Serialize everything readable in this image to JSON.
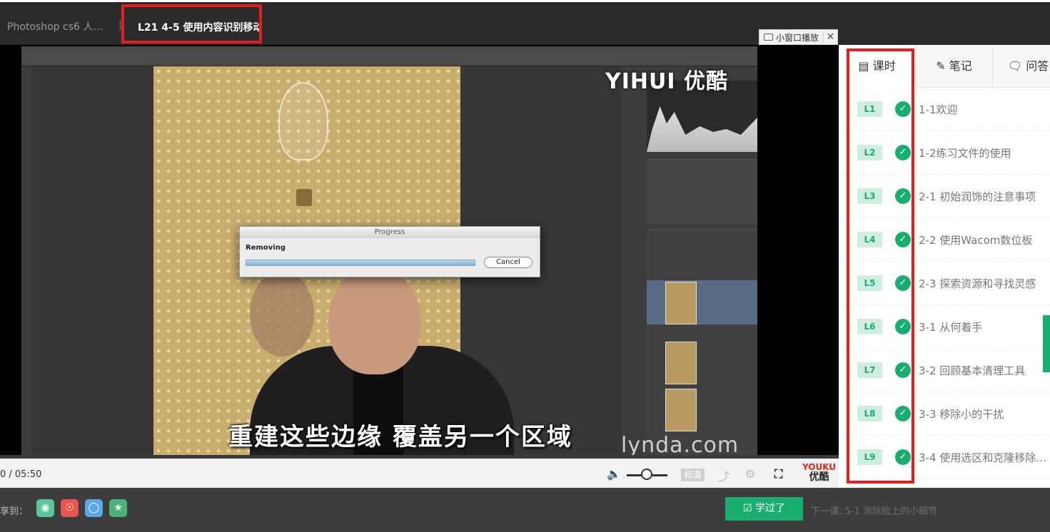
{
  "header": {
    "course_title": "Photoshop cs6 人…",
    "separator": "|",
    "lesson_title": "L21 4-5 使用内容识别移动."
  },
  "mini_player": {
    "label": "小窗口播放",
    "close": "✕"
  },
  "video": {
    "logo_text": "YIHUI 优酷",
    "dialog_title": "Progress",
    "dialog_message": "Removing",
    "dialog_cancel": "Cancel",
    "subtitle": "重建这些边缘 覆盖另一个区域",
    "watermark": "lynda.com"
  },
  "controls": {
    "time": "0 / 05:50",
    "volume_level": 0.45,
    "quality_label": "标清",
    "youku_top": "YOUKU",
    "youku_bottom": "优酷"
  },
  "sidebar": {
    "tabs": [
      {
        "label": "课时",
        "icon": "book-icon"
      },
      {
        "label": "笔记",
        "icon": "edit-icon"
      },
      {
        "label": "问答",
        "icon": "chat-icon"
      }
    ],
    "lessons": [
      {
        "badge": "L1",
        "title": "1-1欢迎"
      },
      {
        "badge": "L2",
        "title": "1-2练习文件的使用"
      },
      {
        "badge": "L3",
        "title": "2-1 初始润饰的注意事项"
      },
      {
        "badge": "L4",
        "title": "2-2 使用Wacom数位板"
      },
      {
        "badge": "L5",
        "title": "2-3 探索资源和寻找灵感"
      },
      {
        "badge": "L6",
        "title": "3-1 从何着手"
      },
      {
        "badge": "L7",
        "title": "3-2 回顾基本清理工具"
      },
      {
        "badge": "L8",
        "title": "3-3 移除小的干扰"
      },
      {
        "badge": "L9",
        "title": "3-4 使用选区和克隆移除…"
      }
    ]
  },
  "share": {
    "label": "享到：",
    "learned_button": "学过了",
    "next_lesson": "下一课: 5-1 消除脸上的小细节"
  },
  "colors": {
    "accent": "#1aad70",
    "highlight": "#e02020"
  }
}
